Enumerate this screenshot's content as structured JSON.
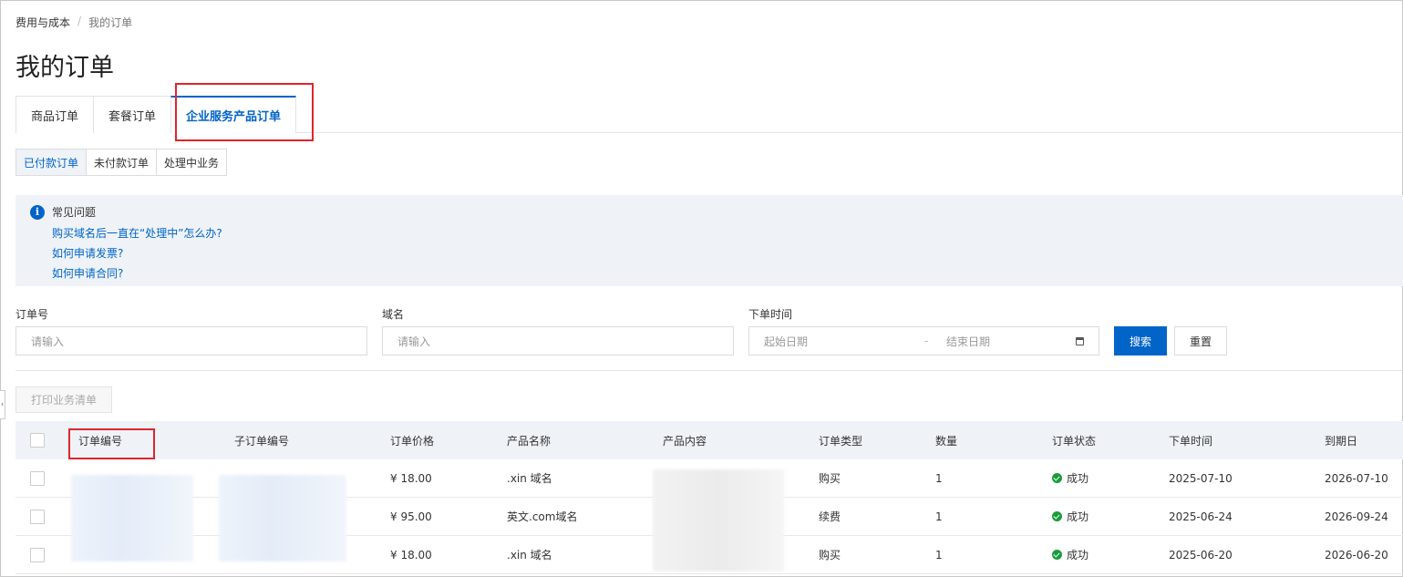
{
  "breadcrumb": {
    "parent": "费用与成本",
    "current": "我的订单"
  },
  "page_title": "我的订单",
  "tabs": [
    {
      "label": "商品订单"
    },
    {
      "label": "套餐订单"
    },
    {
      "label": "企业服务产品订单"
    }
  ],
  "subtabs": [
    {
      "label": "已付款订单"
    },
    {
      "label": "未付款订单"
    },
    {
      "label": "处理中业务"
    }
  ],
  "faq": {
    "title": "常见问题",
    "links": [
      "购买域名后一直在“处理中”怎么办?",
      "如何申请发票?",
      "如何申请合同?"
    ]
  },
  "filters": {
    "order_no_label": "订单号",
    "order_no_placeholder": "请输入",
    "domain_label": "域名",
    "domain_placeholder": "请输入",
    "time_label": "下单时间",
    "start_placeholder": "起始日期",
    "end_placeholder": "结束日期",
    "range_sep": "-",
    "search_label": "搜索",
    "reset_label": "重置"
  },
  "print_label": "打印业务清单",
  "table": {
    "headers": [
      "订单编号",
      "子订单编号",
      "订单价格",
      "产品名称",
      "产品内容",
      "订单类型",
      "数量",
      "订单状态",
      "下单时间",
      "到期日"
    ],
    "rows": [
      {
        "price": "¥ 18.00",
        "product": ".xin 域名",
        "type": "购买",
        "qty": "1",
        "status": "成功",
        "ordered": "2025-07-10",
        "expires": "2026-07-10"
      },
      {
        "price": "¥ 95.00",
        "product": "英文.com域名",
        "type": "续费",
        "qty": "1",
        "status": "成功",
        "ordered": "2025-06-24",
        "expires": "2026-09-24"
      },
      {
        "price": "¥ 18.00",
        "product": ".xin 域名",
        "type": "购买",
        "qty": "1",
        "status": "成功",
        "ordered": "2025-06-20",
        "expires": "2026-06-20"
      }
    ]
  },
  "colors": {
    "accent": "#0064c8",
    "highlight": "#e0242c",
    "success": "#1a9c3a"
  }
}
